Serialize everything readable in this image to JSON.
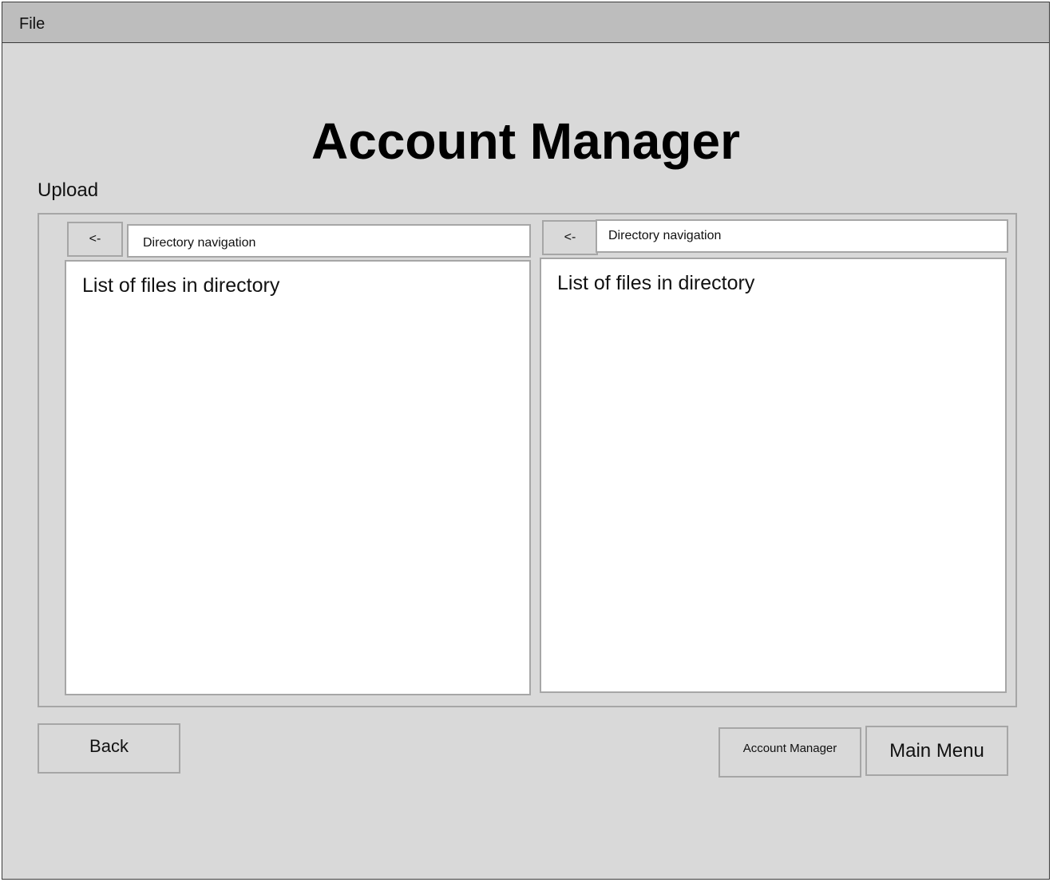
{
  "menubar": {
    "file_label": "File"
  },
  "title": "Account Manager",
  "section_label": "Upload",
  "panes": [
    {
      "back_label": "<-",
      "directory_label": "Directory navigation",
      "list_label": "List of files in directory"
    },
    {
      "back_label": "<-",
      "directory_label": "Directory navigation",
      "list_label": "List of files in directory"
    }
  ],
  "footer": {
    "back_label": "Back",
    "account_manager_label": "Account Manager",
    "main_menu_label": "Main Menu"
  }
}
